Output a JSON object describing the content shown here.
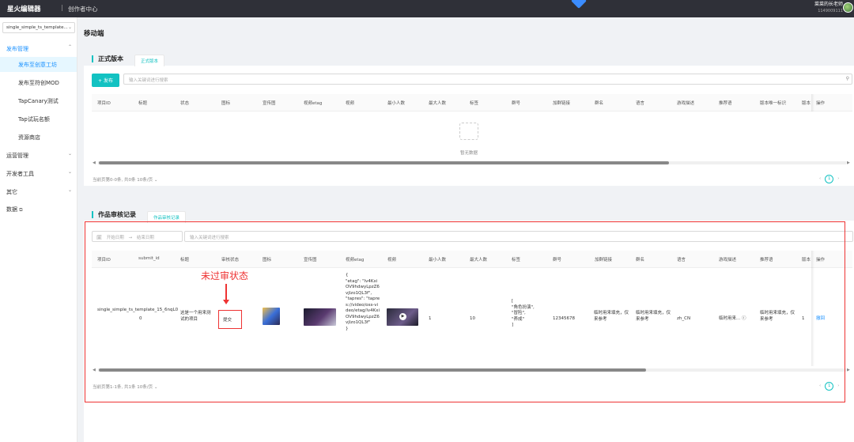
{
  "topbar": {
    "brand": "星火编辑器",
    "separator": "|",
    "subtitle": "创作者中心",
    "user_name": "菜菜的长老师",
    "user_id": "1149009111"
  },
  "sidebar": {
    "project_selector": "single_simple_ts_template...",
    "groups": [
      {
        "label": "发布管理",
        "expanded": true
      },
      {
        "label": "运营管理"
      },
      {
        "label": "开发者工具"
      },
      {
        "label": "其它"
      },
      {
        "label": "数据"
      }
    ],
    "items": [
      {
        "label": "发布至创意工坊",
        "active": true
      },
      {
        "label": "发布至符创MOD"
      },
      {
        "label": "TapCanary测试"
      },
      {
        "label": "Tap试玩名额"
      },
      {
        "label": "资源商店"
      }
    ]
  },
  "page_title": "移动端",
  "release": {
    "title": "正式版本",
    "tab": "正式版本",
    "add_button": "+ 发布",
    "search_placeholder": "输入关键词进行搜索",
    "columns": [
      "项目ID",
      "标题",
      "状态",
      "图标",
      "宣传图",
      "视频etag",
      "视频",
      "最小人数",
      "最大人数",
      "标签",
      "群号",
      "加群链接",
      "群名",
      "语言",
      "游戏描述",
      "推荐语",
      "版本唯一标识",
      "版本",
      "操作"
    ],
    "empty_text": "暂无数据",
    "footer": "当前页第0-0条, 共0条  10条/页",
    "page": "1"
  },
  "review": {
    "title": "作品审核记录",
    "tab": "作品审核记录",
    "start_date": "开始日期",
    "end_date": "结束日期",
    "search_placeholder": "输入关键词进行搜索",
    "columns": [
      "项目ID",
      "submit_id",
      "标题",
      "审核状态",
      "图标",
      "宣传图",
      "视频etag",
      "视频",
      "最小人数",
      "最大人数",
      "标签",
      "群号",
      "加群链接",
      "群名",
      "语言",
      "游戏描述",
      "推荐语",
      "版本",
      "操作"
    ],
    "row": {
      "project_id": "single_simple_ts_template_15_6nqL0",
      "submit_id": "0",
      "title": "这是一个用来测试的项目",
      "status": "提交",
      "video_etag": "{\n\"etag\": \"lv4KxiOV9hdwyLpzZ6vjlzo1QL3f\",\n\"tapres\": \"tapres://video/oss-video/etag/lv4KxiOV9hdwyLpzZ6vjlzo1QL3f\"\n}",
      "min_players": "1",
      "max_players": "10",
      "tags": "[\n\"角色扮演\",\n\"冒险\",\n\"养成\"\n]",
      "group_no": "12345678",
      "group_link": "临时用来填充，仅来参考",
      "group_name": "临时用来填充，仅来参考",
      "language": "zh_CN",
      "description": "临时用来... ⓘ",
      "recommend": "临时用来填充，仅来参考",
      "version": "1",
      "action": "撤回"
    },
    "footer": "当前页第1-1条, 共1条  10条/页",
    "page": "1"
  },
  "annotation": {
    "text": "未过审状态",
    "color": "#e33333"
  },
  "colors": {
    "accent": "#13c2c2",
    "link": "#1890ff",
    "topbar": "#2f3038"
  }
}
